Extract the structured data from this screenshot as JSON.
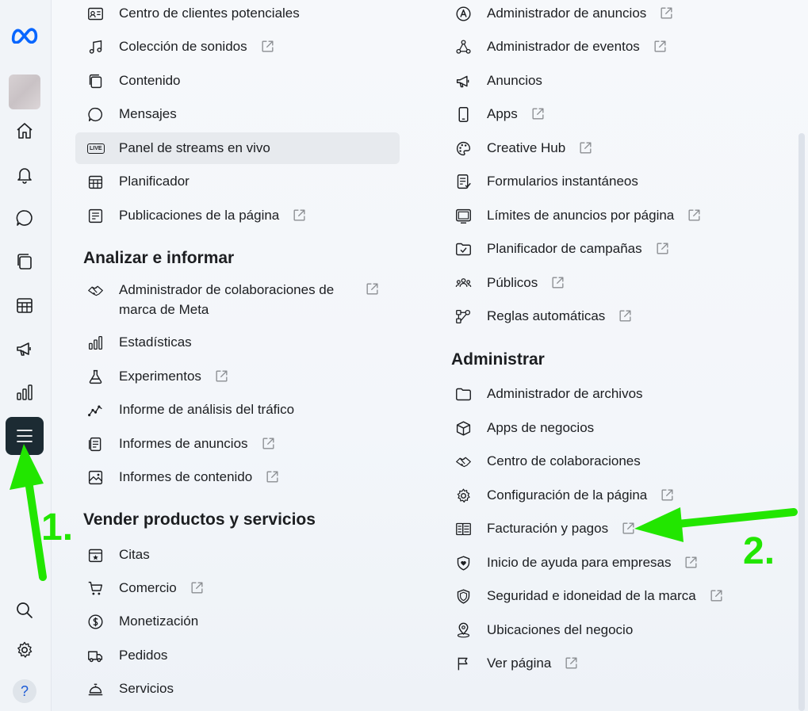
{
  "rail": {
    "items": [
      {
        "name": "meta-logo-icon"
      },
      {
        "name": "home-icon"
      },
      {
        "name": "bell-icon"
      },
      {
        "name": "chat-icon"
      },
      {
        "name": "content-icon"
      },
      {
        "name": "calendar-grid-icon"
      },
      {
        "name": "megaphone-icon"
      },
      {
        "name": "bar-chart-icon"
      },
      {
        "name": "menu-icon",
        "active": true
      },
      {
        "name": "search-icon"
      },
      {
        "name": "gear-icon"
      },
      {
        "name": "help-icon"
      }
    ],
    "help_label": "?"
  },
  "left_column": {
    "items_top": [
      {
        "label": "Centro de clientes potenciales",
        "icon": "contact-card-icon",
        "external": false
      },
      {
        "label": "Colección de sonidos",
        "icon": "music-note-icon",
        "external": true
      },
      {
        "label": "Contenido",
        "icon": "content-icon",
        "external": false
      },
      {
        "label": "Mensajes",
        "icon": "chat-icon",
        "external": false
      },
      {
        "label": "Panel de streams en vivo",
        "icon": "live-icon",
        "external": false,
        "selected": true
      },
      {
        "label": "Planificador",
        "icon": "calendar-grid-icon",
        "external": false
      },
      {
        "label": "Publicaciones de la página",
        "icon": "page-posts-icon",
        "external": true
      }
    ],
    "live_badge": "LIVE",
    "section_analyze": "Analizar e informar",
    "items_analyze": [
      {
        "label": "Administrador de colaboraciones de marca de Meta",
        "icon": "handshake-icon",
        "external": true
      },
      {
        "label": "Estadísticas",
        "icon": "bar-chart-icon",
        "external": false
      },
      {
        "label": "Experimentos",
        "icon": "flask-icon",
        "external": true
      },
      {
        "label": "Informe de análisis del tráfico",
        "icon": "trend-line-icon",
        "external": false
      },
      {
        "label": "Informes de anuncios",
        "icon": "report-icon",
        "external": true
      },
      {
        "label": "Informes de contenido",
        "icon": "image-icon",
        "external": true
      }
    ],
    "section_sell": "Vender productos y servicios",
    "items_sell": [
      {
        "label": "Citas",
        "icon": "appointment-icon",
        "external": false
      },
      {
        "label": "Comercio",
        "icon": "cart-icon",
        "external": true
      },
      {
        "label": "Monetización",
        "icon": "dollar-icon",
        "external": false
      },
      {
        "label": "Pedidos",
        "icon": "truck-icon",
        "external": false
      },
      {
        "label": "Servicios",
        "icon": "service-bell-icon",
        "external": false
      }
    ]
  },
  "right_column": {
    "items_top": [
      {
        "label": "Administrador de anuncios",
        "icon": "ads-manager-icon",
        "external": true
      },
      {
        "label": "Administrador de eventos",
        "icon": "events-icon",
        "external": true
      },
      {
        "label": "Anuncios",
        "icon": "megaphone-icon",
        "external": false
      },
      {
        "label": "Apps",
        "icon": "phone-icon",
        "external": true
      },
      {
        "label": "Creative Hub",
        "icon": "palette-icon",
        "external": true
      },
      {
        "label": "Formularios instantáneos",
        "icon": "form-icon",
        "external": false
      },
      {
        "label": "Límites de anuncios por página",
        "icon": "ad-limit-icon",
        "external": true
      },
      {
        "label": "Planificador de campañas",
        "icon": "folder-check-icon",
        "external": true
      },
      {
        "label": "Públicos",
        "icon": "audience-icon",
        "external": true
      },
      {
        "label": "Reglas automáticas",
        "icon": "rules-icon",
        "external": true
      }
    ],
    "section_manage": "Administrar",
    "items_manage": [
      {
        "label": "Administrador de archivos",
        "icon": "folder-icon",
        "external": false
      },
      {
        "label": "Apps de negocios",
        "icon": "cube-icon",
        "external": false
      },
      {
        "label": "Centro de colaboraciones",
        "icon": "handshake-icon",
        "external": false
      },
      {
        "label": "Configuración de la página",
        "icon": "gear-icon",
        "external": true
      },
      {
        "label": "Facturación y pagos",
        "icon": "billing-icon",
        "external": true
      },
      {
        "label": "Inicio de ayuda para empresas",
        "icon": "shield-heart-icon",
        "external": true
      },
      {
        "label": "Seguridad e idoneidad de la marca",
        "icon": "shield-icon",
        "external": true
      },
      {
        "label": "Ubicaciones del negocio",
        "icon": "location-pin-icon",
        "external": false
      },
      {
        "label": "Ver página",
        "icon": "flag-icon",
        "external": true
      }
    ]
  },
  "annotations": {
    "step1": "1.",
    "step2": "2.",
    "arrow_color": "#22e600"
  },
  "colors": {
    "active_rail_bg": "#1c2b33",
    "selected_item_bg": "#e7eaee",
    "meta_blue": "#0866ff"
  }
}
